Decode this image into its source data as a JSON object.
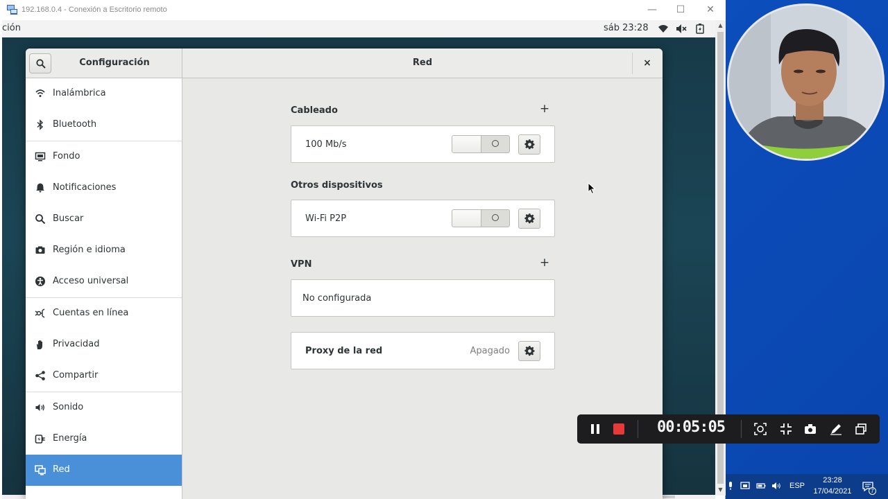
{
  "rdp": {
    "title": "192.168.0.4 - Conexión a Escritorio remoto",
    "icon": "remote-desktop-icon"
  },
  "guest_topbar": {
    "activities": "ción",
    "clock": "sáb 23:28",
    "tray_icons": [
      "wifi-icon",
      "volume-muted-icon",
      "battery-icon"
    ]
  },
  "settings": {
    "app_title": "Configuración",
    "panel_title": "Red",
    "close_glyph": "×",
    "sidebar": [
      {
        "label": "Inalámbrica",
        "icon": "wifi-icon"
      },
      {
        "label": "Bluetooth",
        "icon": "bluetooth-icon"
      },
      {
        "label": "Fondo",
        "icon": "background-icon"
      },
      {
        "label": "Notificaciones",
        "icon": "bell-icon"
      },
      {
        "label": "Buscar",
        "icon": "search-icon"
      },
      {
        "label": "Región e idioma",
        "icon": "camera-region-icon"
      },
      {
        "label": "Acceso universal",
        "icon": "accessibility-icon"
      },
      {
        "label": "Cuentas en línea",
        "icon": "online-accounts-icon"
      },
      {
        "label": "Privacidad",
        "icon": "hand-icon"
      },
      {
        "label": "Compartir",
        "icon": "share-icon"
      },
      {
        "label": "Sonido",
        "icon": "speaker-icon"
      },
      {
        "label": "Energía",
        "icon": "power-icon"
      },
      {
        "label": "Red",
        "icon": "network-icon",
        "active": true
      }
    ],
    "sections": {
      "wired": {
        "title": "Cableado",
        "add": "+",
        "row_label": "100 Mb/s",
        "enabled": false
      },
      "other": {
        "title": "Otros dispositivos",
        "row_label": "Wi-Fi P2P",
        "enabled": false
      },
      "vpn": {
        "title": "VPN",
        "add": "+",
        "row_label": "No configurada"
      },
      "proxy": {
        "row_label": "Proxy de la red",
        "status": "Apagado"
      }
    }
  },
  "recorder": {
    "timer": "00:05:05",
    "buttons": [
      "pause-icon",
      "stop-icon",
      "screenshot-region-icon",
      "collapse-icon",
      "camera-icon",
      "pen-icon",
      "window-icon"
    ],
    "stop_color": "#e5393a"
  },
  "taskbar": {
    "lang": "ESP",
    "time": "23:28",
    "date": "17/04/2021",
    "notification_count": "7"
  },
  "colors": {
    "accent": "#4a90d9",
    "desktop": "#0c4fbf"
  }
}
